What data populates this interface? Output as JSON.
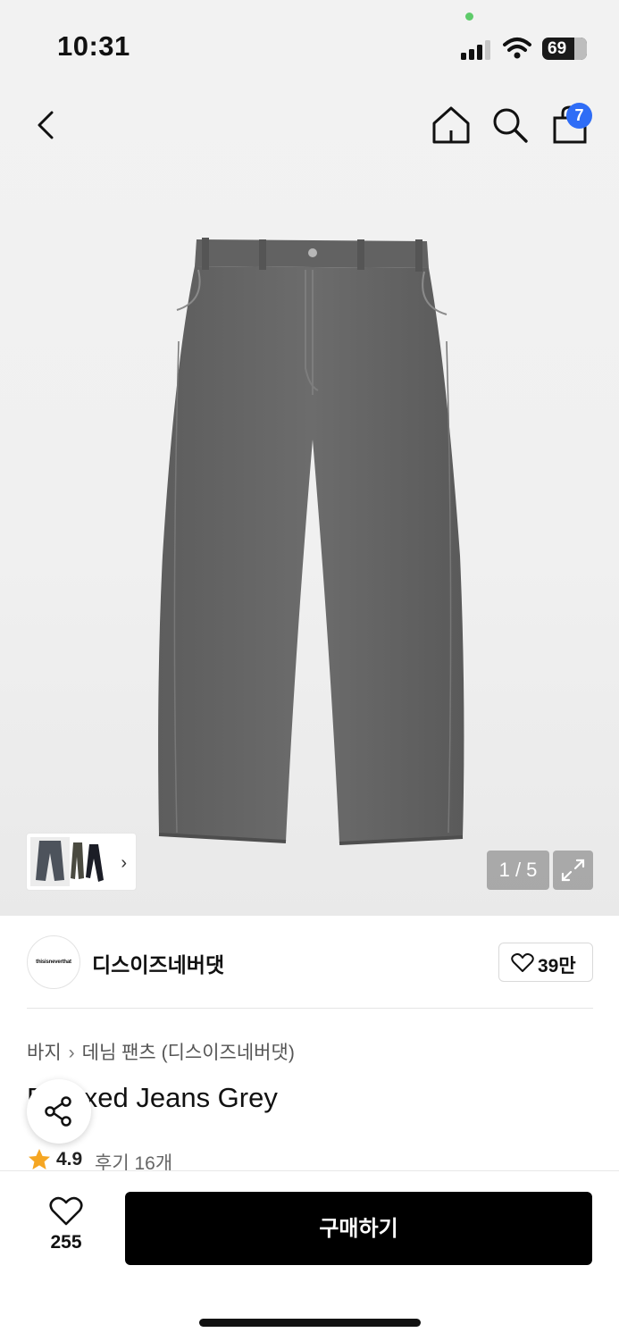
{
  "status_bar": {
    "time": "10:31",
    "battery": "69"
  },
  "header": {
    "back_icon": "chevron-left-icon",
    "home_icon": "home-icon",
    "search_icon": "search-icon",
    "cart_icon": "shopping-bag-icon",
    "cart_count": "7",
    "badge_color": "#2f6df6"
  },
  "gallery": {
    "counter": "1 / 5",
    "expand_icon": "expand-icon",
    "thumb_chevron": "›"
  },
  "brand": {
    "logo_text": "thisisneverthat",
    "name": "디스이즈네버댓",
    "like_count": "39만"
  },
  "product": {
    "breadcrumb": [
      "바지",
      "데님 팬츠 (디스이즈네버댓)"
    ],
    "breadcrumb_sep": "›",
    "title": "Relaxed Jeans Grey",
    "rating": "4.9",
    "reviews": "후기 16개",
    "star_color": "#f5a623"
  },
  "bottom_bar": {
    "wish_count": "255",
    "buy_label": "구매하기"
  }
}
